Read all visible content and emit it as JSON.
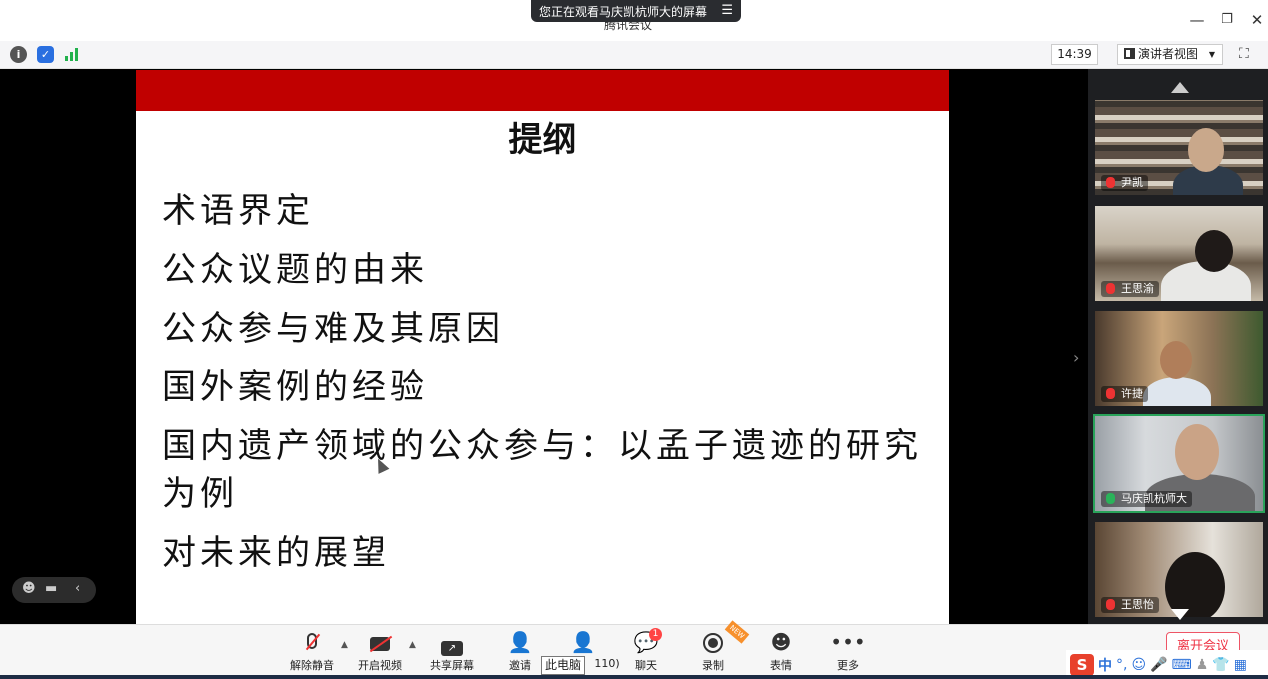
{
  "window": {
    "share_banner": "您正在观看马庆凯杭师大的屏幕",
    "app_title": "腾讯会议",
    "minimize_glyph": "—",
    "restore_glyph": "❐",
    "close_glyph": "✕"
  },
  "topbar": {
    "time": "14:39",
    "view_mode": "演讲者视图",
    "icons": [
      "info-icon",
      "shield-icon",
      "signal-icon",
      "fullscreen-icon"
    ]
  },
  "slide": {
    "title": "提纲",
    "items": [
      "术语界定",
      "公众议题的由来",
      "公众参与难及其原因",
      "国外案例的经验",
      "国内遗产领域的公众参与：以孟子遗迹的研究为例",
      "对未来的展望"
    ],
    "header_color": "#c00000"
  },
  "participants": [
    {
      "name": "尹凯",
      "mic": "muted"
    },
    {
      "name": "王思渝",
      "mic": "muted"
    },
    {
      "name": "许捷",
      "mic": "muted"
    },
    {
      "name": "马庆凯杭师大",
      "mic": "active"
    },
    {
      "name": "王思怡",
      "mic": "muted"
    }
  ],
  "controls": {
    "unmute": "解除静音",
    "start_video": "开启视频",
    "share_screen": "共享屏幕",
    "invite": "邀请",
    "members": "110)",
    "chat": "聊天",
    "chat_badge": "1",
    "record": "录制",
    "record_tag": "NEW",
    "reactions": "表情",
    "more": "更多",
    "leave": "离开会议"
  },
  "tooltip": "此电脑",
  "ime": {
    "logo": "S",
    "lang": "中"
  }
}
